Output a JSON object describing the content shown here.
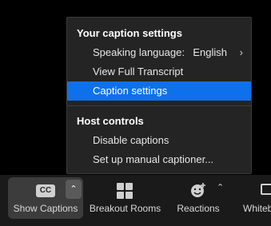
{
  "menu": {
    "caption_section_title": "Your caption settings",
    "speaking_language_label": "Speaking language:",
    "speaking_language_value": "English",
    "view_transcript_label": "View Full Transcript",
    "caption_settings_label": "Caption settings",
    "host_section_title": "Host controls",
    "disable_captions_label": "Disable captions",
    "manual_captioner_label": "Set up manual captioner..."
  },
  "toolbar": {
    "cc_icon_text": "CC",
    "show_captions_label": "Show Captions",
    "breakout_label": "Breakout Rooms",
    "reactions_label": "Reactions",
    "whiteboard_label": "Whiteb"
  },
  "colors": {
    "menu_bg": "#242424",
    "selected_bg": "#0e71eb",
    "toolbar_bg": "#1a1a1a"
  }
}
